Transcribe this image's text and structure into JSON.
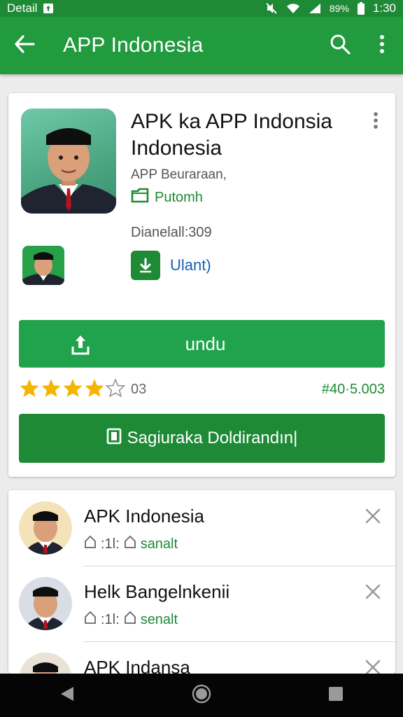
{
  "status_bar": {
    "left_label": "Detail",
    "battery_percent": "89%",
    "time": "1:30"
  },
  "app_bar": {
    "title": "APP Indonesia",
    "icons": [
      "back-arrow-icon",
      "search-icon",
      "overflow-menu-icon"
    ]
  },
  "detail": {
    "title_line1": "APK ka APP Indonsia",
    "title_line2": "Indonesia",
    "developer": "APP Beuraraan,",
    "category": "Putomh",
    "downloads": "Dianelall:309",
    "update_label": "Ulant)",
    "install_label": "undu",
    "rating_stars": 4,
    "rating_count": "03",
    "size": "#40·5.003",
    "secondary_label": "Sagiuraka Doldirandın|"
  },
  "list": {
    "items": [
      {
        "title": "APK Indonesia",
        "meta_a": ":1l:",
        "meta_b": "sanalt"
      },
      {
        "title": "Helk Bangelnkenii",
        "meta_a": ":1l:",
        "meta_b": "senalt"
      },
      {
        "title": "APK Indansa",
        "meta_a": "",
        "meta_b": ""
      }
    ]
  },
  "colors": {
    "status_bar": "#1e8a36",
    "app_bar": "#229a3e",
    "install_button": "#21a24c",
    "secondary_button": "#1e8a36",
    "star": "#f4b400"
  }
}
